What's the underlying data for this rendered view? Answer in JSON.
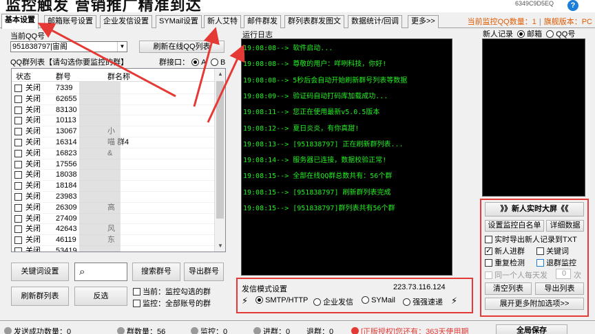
{
  "window": {
    "title": "监控触发 营销推广精准到达",
    "machine_id": "6349C9D5EQ",
    "help_label": "?"
  },
  "tabs": [
    "基本设置",
    "邮箱账号设置",
    "企业发信设置",
    "SYMail设置",
    "新人艾特",
    "邮件群发",
    "群列表群发图文",
    "数据统计/回调",
    "更多>>"
  ],
  "active_tab": "基本设置",
  "header_status": {
    "monitor_count_label": "当前监控QQ数量：1",
    "separator": "|",
    "version": "旗舰版本：PC"
  },
  "left": {
    "current_qq_label": "当前QQ号",
    "qq_select": "951838797|宙阁",
    "refresh_online_button": "刷新在线QQ列表",
    "group_list_label": "QQ群列表【请勾选你要监控的群】",
    "group_port_label": "群接口：",
    "port_a": "A",
    "port_b": "B",
    "columns": [
      "状态",
      "群号",
      "群名称"
    ],
    "rows": [
      {
        "status": "关闭",
        "num": "7339",
        "name": ""
      },
      {
        "status": "关闭",
        "num": "62655",
        "name": ""
      },
      {
        "status": "关闭",
        "num": "83130",
        "name": ""
      },
      {
        "status": "关闭",
        "num": "10113",
        "name": ""
      },
      {
        "status": "关闭",
        "num": "13067",
        "name": "小"
      },
      {
        "status": "关闭",
        "num": "16314",
        "name": "喵          群4"
      },
      {
        "status": "关闭",
        "num": "16823",
        "name": "&"
      },
      {
        "status": "关闭",
        "num": "17556",
        "name": ""
      },
      {
        "status": "关闭",
        "num": "18038",
        "name": ""
      },
      {
        "status": "关闭",
        "num": "18184",
        "name": ""
      },
      {
        "status": "关闭",
        "num": "23983",
        "name": ""
      },
      {
        "status": "关闭",
        "num": "26309",
        "name": "高"
      },
      {
        "status": "关闭",
        "num": "27409",
        "name": ""
      },
      {
        "status": "关闭",
        "num": "42643",
        "name": "风"
      },
      {
        "status": "关闭",
        "num": "46119",
        "name": "东"
      },
      {
        "status": "关闭",
        "num": "53419",
        "name": ""
      }
    ],
    "keyword_button": "关键词设置",
    "search_group_button": "搜索群号",
    "export_group_button": "导出群号",
    "refresh_groups_button": "刷新群列表",
    "invert_button": "反选",
    "monitor_checked_label": "当前：监控勾选的群",
    "monitor_all_label": "监控：全部账号的群"
  },
  "log": {
    "title": "运行日志",
    "lines": [
      "19:08:08--> 软件启动...",
      "19:08:08--> 尊敬的用户：咩咧科技，你好!",
      "19:08:08--> 5秒后会自动开始刷新群号列表等数据",
      "19:08:09--> 验证码自动打码库加载成功...",
      "19:08:11--> 您正在使用最新v5.0.5版本",
      "19:08:12--> 夏日炎炎，有你真甜!",
      "19:08:13--> [951838797] 正在刷新群列表...",
      "19:08:14--> 服务器已连接，数据校验正常!",
      "19:08:15--> 全部在线QQ群总数共有：56个群",
      "19:08:15--> [951838797] 刷新群列表完成",
      "19:08:15--> [951838797]群列表共有56个群"
    ]
  },
  "send_mode": {
    "label": "发信模式设置",
    "ip": "223.73.116.124",
    "options": [
      "SMTP/HTTP",
      "企业发信",
      "SYMail",
      "强强速递"
    ]
  },
  "records": {
    "label": "新人记录",
    "mail_option": "邮箱",
    "qq_option": "QQ号"
  },
  "right_panel": {
    "big_screen_button": "》》新人实时大屏《《",
    "whitelist_button": "设置监控白名单",
    "detail_button": "详细数据",
    "export_txt_label": "实时导出新人记录到TXT",
    "new_join_label": "新人进群",
    "keyword_label": "关键词",
    "repeat_check_label": "重复检测",
    "quit_monitor_label": "退群监控",
    "daily_limit_label": "同一个人每天发",
    "daily_limit_value": "0",
    "daily_limit_unit": "次",
    "clear_list_button": "清空列表",
    "export_list_button": "导出列表",
    "expand_button": "展开更多附加选项>>"
  },
  "statusbar": {
    "sent_success": "发送成功数量：0",
    "group_count": "群数量：56",
    "monitoring": "监控：0",
    "joined": "进群：0",
    "quit": "退群：0",
    "license": "[正版授权]您还有：363天使用期",
    "save_button": "全局保存"
  },
  "colors": {
    "annotation_red": "#e53935",
    "log_text": "#22ee22",
    "status_orange": "#e05a00"
  }
}
